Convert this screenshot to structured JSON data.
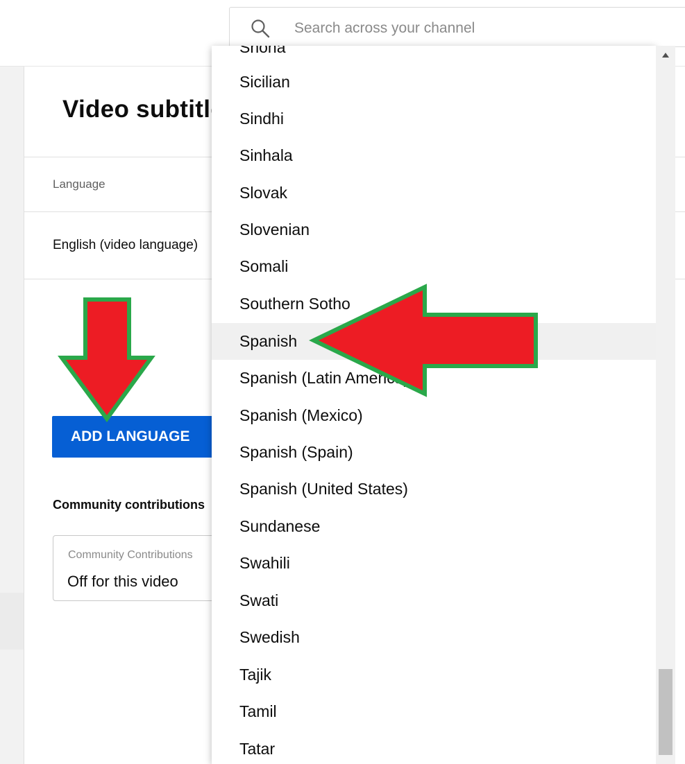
{
  "search": {
    "placeholder": "Search across your channel"
  },
  "page": {
    "title": "Video subtitles",
    "column_language": "Language",
    "row_language": "English (video language)",
    "add_language_label": "ADD LANGUAGE",
    "community_heading": "Community contributions",
    "community_select_label": "Community Contributions",
    "community_select_value": "Off for this video"
  },
  "dropdown": {
    "partial_top_item": "Shona",
    "items": [
      "Sicilian",
      "Sindhi",
      "Sinhala",
      "Slovak",
      "Slovenian",
      "Somali",
      "Southern Sotho",
      "Spanish",
      "Spanish (Latin America)",
      "Spanish (Mexico)",
      "Spanish (Spain)",
      "Spanish (United States)",
      "Sundanese",
      "Swahili",
      "Swati",
      "Swedish",
      "Tajik",
      "Tamil",
      "Tatar"
    ],
    "selected": "Spanish"
  },
  "icons": {
    "search": "search-icon",
    "scroll_up": "scroll-up-arrow-icon",
    "annotation_arrow_down": "red-arrow-down-icon",
    "annotation_arrow_left": "red-arrow-left-icon"
  },
  "colors": {
    "primary_button": "#065fd4",
    "annotation_fill": "#ed1c24",
    "annotation_stroke": "#2aa84a",
    "selected_item_bg": "#f0f0f0"
  }
}
